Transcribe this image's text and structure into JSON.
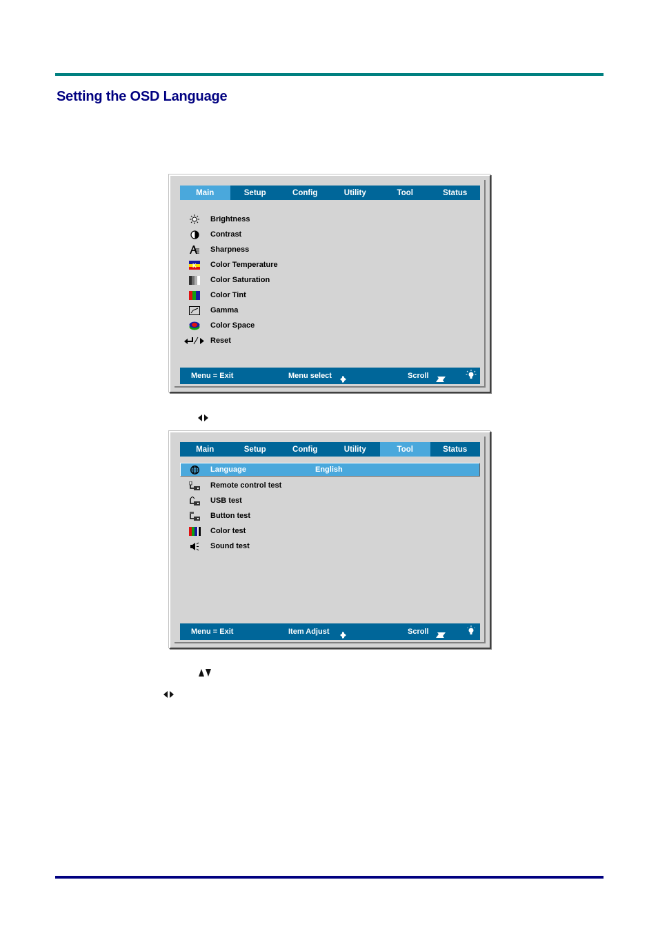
{
  "page": {
    "title": "Setting the OSD Language",
    "colors": {
      "top_rule": "#008080",
      "bottom_rule": "#000080",
      "title": "#000080",
      "osd_bar": "#006699",
      "osd_active": "#4aa8dc",
      "osd_bg": "#d4d4d4"
    }
  },
  "osd1": {
    "tabs": [
      {
        "label": "Main",
        "active": true
      },
      {
        "label": "Setup",
        "active": false
      },
      {
        "label": "Config",
        "active": false
      },
      {
        "label": "Utility",
        "active": false
      },
      {
        "label": "Tool",
        "active": false
      },
      {
        "label": "Status",
        "active": false
      }
    ],
    "items": [
      {
        "icon": "brightness-icon",
        "label": "Brightness"
      },
      {
        "icon": "contrast-icon",
        "label": "Contrast"
      },
      {
        "icon": "sharpness-icon",
        "label": "Sharpness"
      },
      {
        "icon": "color-temperature-icon",
        "label": "Color Temperature"
      },
      {
        "icon": "color-saturation-icon",
        "label": "Color Saturation"
      },
      {
        "icon": "color-tint-icon",
        "label": "Color Tint"
      },
      {
        "icon": "gamma-icon",
        "label": "Gamma"
      },
      {
        "icon": "color-space-icon",
        "label": "Color Space"
      },
      {
        "icon": "reset-icon",
        "label": "Reset"
      }
    ],
    "footer": {
      "exit": "Menu = Exit",
      "mid": "Menu select",
      "scroll": "Scroll"
    }
  },
  "osd2": {
    "tabs": [
      {
        "label": "Main",
        "active": false
      },
      {
        "label": "Setup",
        "active": false
      },
      {
        "label": "Config",
        "active": false
      },
      {
        "label": "Utility",
        "active": false
      },
      {
        "label": "Tool",
        "active": true
      },
      {
        "label": "Status",
        "active": false
      }
    ],
    "items": [
      {
        "icon": "globe-icon",
        "label": "Language",
        "value": "English",
        "selected": true
      },
      {
        "icon": "remote-control-icon",
        "label": "Remote control test"
      },
      {
        "icon": "usb-icon",
        "label": "USB test"
      },
      {
        "icon": "button-test-icon",
        "label": "Button test"
      },
      {
        "icon": "color-test-icon",
        "label": "Color test"
      },
      {
        "icon": "speaker-icon",
        "label": "Sound test"
      }
    ],
    "footer": {
      "exit": "Menu = Exit",
      "mid": "Item Adjust",
      "scroll": "Scroll"
    }
  },
  "doc_arrows": [
    {
      "icon": "left-right-arrows-icon"
    },
    {
      "icon": "up-down-arrows-icon"
    },
    {
      "icon": "left-right-arrows-icon"
    }
  ]
}
